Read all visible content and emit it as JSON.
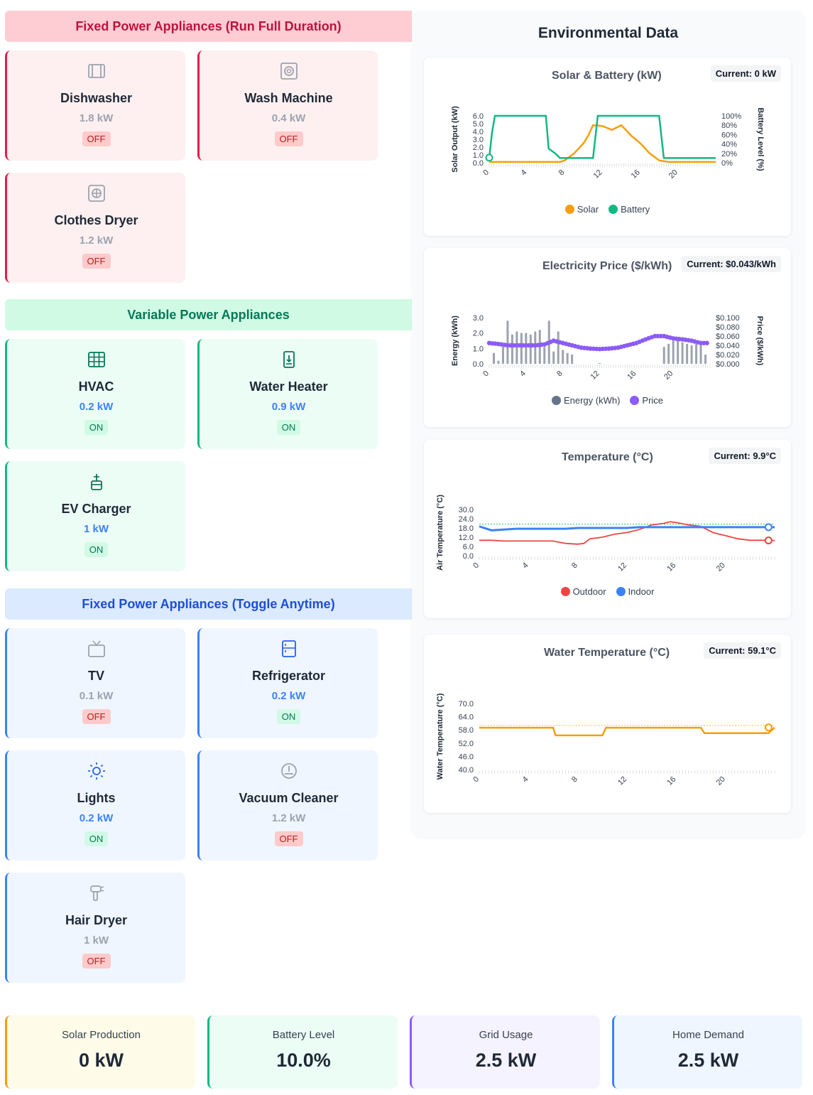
{
  "sections": {
    "fixed_full": {
      "title": "Fixed Power Appliances (Run Full Duration)"
    },
    "variable": {
      "title": "Variable Power Appliances"
    },
    "fixed_toggle": {
      "title": "Fixed Power Appliances (Toggle Anytime)"
    }
  },
  "appliances": [
    {
      "name": "Dishwasher",
      "power": "1.8 kW",
      "status": "OFF",
      "icon": "dishwasher-icon"
    },
    {
      "name": "Wash Machine",
      "power": "0.4 kW",
      "status": "OFF",
      "icon": "washing-machine-icon"
    },
    {
      "name": "Clothes Dryer",
      "power": "1.2 kW",
      "status": "OFF",
      "icon": "dryer-icon"
    },
    {
      "name": "HVAC",
      "power": "0.2 kW",
      "status": "ON",
      "icon": "hvac-icon"
    },
    {
      "name": "Water Heater",
      "power": "0.9 kW",
      "status": "ON",
      "icon": "water-heater-icon"
    },
    {
      "name": "EV Charger",
      "power": "1 kW",
      "status": "ON",
      "icon": "ev-charger-icon"
    },
    {
      "name": "TV",
      "power": "0.1 kW",
      "status": "OFF",
      "icon": "tv-icon"
    },
    {
      "name": "Refrigerator",
      "power": "0.2 kW",
      "status": "ON",
      "icon": "refrigerator-icon"
    },
    {
      "name": "Lights",
      "power": "0.2 kW",
      "status": "ON",
      "icon": "sun-icon"
    },
    {
      "name": "Vacuum Cleaner",
      "power": "1.2 kW",
      "status": "OFF",
      "icon": "vacuum-icon"
    },
    {
      "name": "Hair Dryer",
      "power": "1 kW",
      "status": "OFF",
      "icon": "hair-dryer-icon"
    }
  ],
  "env": {
    "title": "Environmental Data",
    "solar_battery": {
      "title": "Solar & Battery (kW)",
      "current": "Current: 0 kW"
    },
    "price": {
      "title": "Electricity Price ($/kWh)",
      "current": "Current: $0.043/kWh"
    },
    "temperature": {
      "title": "Temperature (°C)",
      "current": "Current: 9.9°C"
    },
    "water": {
      "title": "Water Temperature (°C)",
      "current": "Current: 59.1°C"
    }
  },
  "stats": [
    {
      "label": "Solar Production",
      "value": "0 kW"
    },
    {
      "label": "Battery Level",
      "value": "10.0%"
    },
    {
      "label": "Grid Usage",
      "value": "2.5 kW"
    },
    {
      "label": "Home Demand",
      "value": "2.5 kW"
    }
  ],
  "colors": {
    "solar": "#f59e0b",
    "battery": "#10b981",
    "energy": "#64748b",
    "price": "#8b5cf6",
    "outdoor": "#ef4444",
    "indoor": "#3b82f6",
    "water": "#f59e0b"
  },
  "chart_data": [
    {
      "type": "line",
      "title": "Solar & Battery (kW)",
      "ylabel": "Solar Output (kW)",
      "y2label": "Battery Level (%)",
      "y_ticks": [
        "0.0",
        "1.0",
        "2.0",
        "3.0",
        "4.0",
        "5.0",
        "6.0"
      ],
      "y2_ticks": [
        "0%",
        "20%",
        "40%",
        "60%",
        "80%",
        "100%"
      ],
      "x_ticks": [
        "0",
        "4",
        "8",
        "12",
        "16",
        "20"
      ],
      "ylim": [
        0,
        6
      ],
      "y2lim": [
        0,
        100
      ],
      "xlim": [
        0,
        24
      ],
      "series": [
        {
          "name": "Solar",
          "axis": "left",
          "x": [
            0,
            6.5,
            7.5,
            8,
            9,
            10,
            10.5,
            11,
            12,
            13,
            14,
            15,
            16,
            17,
            18,
            19,
            24
          ],
          "y": [
            0.1,
            0.1,
            0.1,
            0.3,
            1.2,
            2.5,
            3.5,
            4.8,
            4.7,
            4.2,
            4.8,
            3.5,
            2.5,
            1.2,
            0.3,
            0.1,
            0.1
          ]
        },
        {
          "name": "Battery",
          "axis": "right",
          "x": [
            0,
            0.3,
            0.6,
            6,
            6.3,
            7,
            7.5,
            11,
            11.5,
            18,
            18.5,
            24
          ],
          "y": [
            10,
            65,
            100,
            100,
            30,
            20,
            10,
            10,
            100,
            100,
            10,
            10
          ]
        }
      ]
    },
    {
      "type": "bar",
      "title": "Electricity Price ($/kWh)",
      "ylabel": "Energy (kWh)",
      "y2label": "Price ($/kWh)",
      "y_ticks": [
        "0.0",
        "1.0",
        "2.0",
        "3.0"
      ],
      "y2_ticks": [
        "$0.000",
        "$0.020",
        "$0.040",
        "$0.060",
        "$0.080",
        "$0.100"
      ],
      "x_ticks": [
        "0",
        "4",
        "8",
        "12",
        "16",
        "20"
      ],
      "ylim": [
        0,
        3
      ],
      "y2lim": [
        0,
        0.1
      ],
      "xlim": [
        0,
        24
      ],
      "series": [
        {
          "name": "Energy (kWh)",
          "axis": "left",
          "x": [
            0.5,
            1,
            1.5,
            2,
            2.5,
            3,
            3.5,
            4,
            4.5,
            5,
            5.5,
            6,
            6.5,
            7,
            7.5,
            8,
            8.5,
            9,
            12,
            19,
            19.5,
            20,
            20.5,
            21,
            21.5,
            22,
            22.5,
            23,
            23.5
          ],
          "y": [
            0.7,
            0.2,
            1.1,
            2.8,
            1.9,
            2.1,
            2.0,
            2.0,
            1.9,
            2.1,
            2.2,
            1.1,
            2.8,
            0.8,
            2.1,
            0.9,
            0.7,
            0.6,
            0.05,
            1.1,
            1.3,
            1.5,
            1.5,
            1.4,
            1.3,
            1.2,
            1.3,
            1.4,
            0.6
          ]
        },
        {
          "name": "Price",
          "axis": "right",
          "x": [
            0,
            1,
            2,
            3,
            4,
            5,
            6,
            7,
            8,
            9,
            10,
            11,
            12,
            13,
            14,
            15,
            16,
            17,
            18,
            19,
            20,
            21,
            22,
            23
          ],
          "y": [
            0.045,
            0.043,
            0.04,
            0.04,
            0.04,
            0.04,
            0.042,
            0.05,
            0.045,
            0.04,
            0.035,
            0.033,
            0.032,
            0.033,
            0.035,
            0.04,
            0.045,
            0.053,
            0.06,
            0.06,
            0.055,
            0.053,
            0.05,
            0.045
          ]
        }
      ]
    },
    {
      "type": "line",
      "title": "Temperature (°C)",
      "ylabel": "Air Temperature (°C)",
      "y_ticks": [
        "0.0",
        "6.0",
        "12.0",
        "18.0",
        "24.0",
        "30.0"
      ],
      "x_ticks": [
        "0",
        "4",
        "8",
        "12",
        "16",
        "20"
      ],
      "ylim": [
        0,
        30
      ],
      "xlim": [
        0,
        24
      ],
      "series": [
        {
          "name": "Outdoor",
          "x": [
            0,
            1,
            2,
            3,
            4,
            5,
            6,
            7,
            8,
            8.5,
            9,
            10,
            11,
            12,
            13,
            14,
            15,
            15.5,
            16,
            17,
            18,
            19,
            20,
            21,
            22,
            23,
            24
          ],
          "y": [
            10,
            10,
            9.5,
            9.5,
            9.5,
            9.5,
            9.5,
            8,
            7.5,
            8,
            11,
            12,
            14,
            15,
            17,
            20,
            21,
            22,
            21.5,
            20,
            19,
            15,
            13,
            11,
            10,
            10,
            9.9
          ]
        },
        {
          "name": "Indoor",
          "x": [
            0,
            1,
            2,
            3,
            4,
            5,
            6,
            7,
            8,
            9,
            10,
            11,
            12,
            13,
            14,
            15,
            16,
            17,
            18,
            19,
            20,
            21,
            22,
            23,
            24
          ],
          "y": [
            19,
            16.5,
            17,
            17.5,
            17.5,
            17.5,
            17.5,
            17.5,
            18,
            18,
            18,
            18,
            18,
            18.5,
            18.5,
            18.5,
            18.5,
            18.5,
            18.5,
            18.5,
            18.5,
            18.5,
            18.5,
            18.5,
            18.5
          ]
        }
      ]
    },
    {
      "type": "line",
      "title": "Water Temperature (°C)",
      "ylabel": "Water Temperature (°C)",
      "y_ticks": [
        "40.0",
        "46.0",
        "52.0",
        "58.0",
        "64.0",
        "70.0"
      ],
      "x_ticks": [
        "0",
        "4",
        "8",
        "12",
        "16",
        "20"
      ],
      "ylim": [
        40,
        70
      ],
      "xlim": [
        0,
        24
      ],
      "series": [
        {
          "name": "Water",
          "x": [
            0,
            6,
            6.2,
            10,
            10.3,
            15,
            18,
            18.3,
            23.5,
            24
          ],
          "y": [
            59,
            59,
            55.5,
            55.5,
            59,
            59,
            59,
            56.5,
            56.5,
            59.1
          ]
        }
      ]
    }
  ]
}
